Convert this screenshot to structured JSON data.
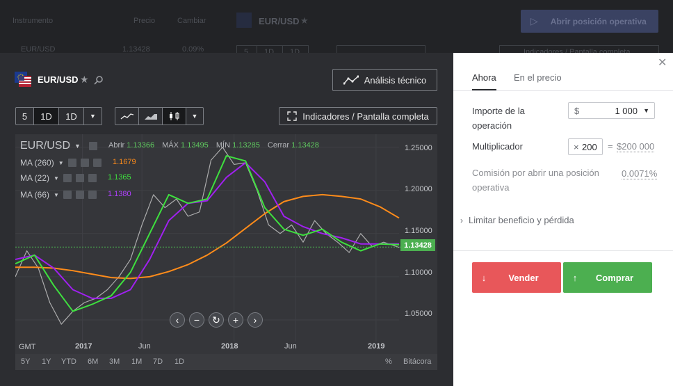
{
  "background": {
    "list_headers": [
      "Instrumento",
      "Precio",
      "Cambiar"
    ],
    "row": {
      "symbol": "EUR/USD",
      "price": "1.13428",
      "change": "0.09%"
    },
    "instrument": "EUR/USD",
    "timeframes": [
      "5",
      "1D",
      "1D"
    ],
    "open_position": "Abrir posición operativa",
    "indicators": "Indicadores / Pantalla completa"
  },
  "chart_header": {
    "instrument": "EUR/USD",
    "analysis_button": "Análisis técnico",
    "timeframes": [
      "5",
      "1D",
      "1D"
    ],
    "indicators_button": "Indicadores / Pantalla completa"
  },
  "chart_data": {
    "type": "line",
    "symbol_label": "EUR/USD",
    "ohlc": [
      {
        "label": "Abrir",
        "value": "1.13366"
      },
      {
        "label": "MÁX",
        "value": "1.13495"
      },
      {
        "label": "MÍN",
        "value": "1.13285"
      },
      {
        "label": "Cerrar",
        "value": "1.13428"
      }
    ],
    "indicators": [
      {
        "name": "MA (260)",
        "value": "1.1679",
        "color": "#ff8c1a"
      },
      {
        "name": "MA (22)",
        "value": "1.1365",
        "color": "#3ee03e"
      },
      {
        "name": "MA (66)",
        "value": "1.1380",
        "color": "#a020f0"
      }
    ],
    "ylim": [
      1.025,
      1.265
    ],
    "y_ticks": [
      "1.25000",
      "1.20000",
      "1.15000",
      "1.10000",
      "1.05000"
    ],
    "x_ticks": [
      "2017",
      "Jun",
      "2018",
      "Jun",
      "2019"
    ],
    "timezone": "GMT",
    "current_price": "1.13428",
    "price_color": "#4caf50",
    "series": [
      {
        "name": "MA (260)",
        "color": "#ff8c1a",
        "x": [
          0,
          5,
          10,
          15,
          20,
          25,
          30,
          35,
          40,
          45,
          50,
          55,
          60,
          65,
          70,
          75,
          80,
          85,
          90,
          95,
          100
        ],
        "values": [
          1.111,
          1.111,
          1.11,
          1.107,
          1.103,
          1.099,
          1.098,
          1.1,
          1.106,
          1.114,
          1.125,
          1.139,
          1.156,
          1.173,
          1.187,
          1.193,
          1.195,
          1.193,
          1.19,
          1.181,
          1.168
        ]
      },
      {
        "name": "MA (22)",
        "color": "#3ee03e",
        "x": [
          0,
          5,
          10,
          15,
          20,
          25,
          30,
          35,
          40,
          45,
          50,
          55,
          60,
          65,
          70,
          75,
          80,
          85,
          90,
          95,
          100
        ],
        "values": [
          1.115,
          1.125,
          1.09,
          1.06,
          1.068,
          1.078,
          1.105,
          1.15,
          1.195,
          1.185,
          1.19,
          1.24,
          1.234,
          1.18,
          1.155,
          1.148,
          1.155,
          1.14,
          1.13,
          1.138,
          1.137
        ]
      },
      {
        "name": "MA (66)",
        "color": "#a020f0",
        "x": [
          0,
          5,
          10,
          15,
          20,
          25,
          30,
          35,
          40,
          45,
          50,
          55,
          60,
          65,
          70,
          75,
          80,
          85,
          90,
          95,
          100
        ],
        "values": [
          1.12,
          1.125,
          1.11,
          1.085,
          1.075,
          1.075,
          1.085,
          1.12,
          1.165,
          1.185,
          1.188,
          1.215,
          1.232,
          1.21,
          1.17,
          1.158,
          1.15,
          1.145,
          1.138,
          1.138,
          1.138
        ]
      },
      {
        "name": "price",
        "color": "#c9c9c9",
        "x": [
          0,
          3,
          6,
          9,
          12,
          15,
          18,
          21,
          24,
          27,
          30,
          33,
          36,
          39,
          42,
          45,
          48,
          51,
          54,
          57,
          60,
          63,
          66,
          69,
          72,
          75,
          78,
          81,
          84,
          87,
          90,
          93,
          96,
          100
        ],
        "values": [
          1.1,
          1.13,
          1.11,
          1.07,
          1.045,
          1.06,
          1.07,
          1.075,
          1.085,
          1.1,
          1.12,
          1.16,
          1.195,
          1.18,
          1.19,
          1.17,
          1.175,
          1.235,
          1.25,
          1.23,
          1.232,
          1.2,
          1.16,
          1.15,
          1.16,
          1.14,
          1.165,
          1.15,
          1.14,
          1.128,
          1.15,
          1.135,
          1.14,
          1.134
        ]
      }
    ]
  },
  "chart_controls": {
    "ranges": [
      "5Y",
      "1Y",
      "YTD",
      "6M",
      "3M",
      "1M",
      "7D",
      "1D"
    ],
    "percent": "%",
    "log": "Bitácora"
  },
  "panel": {
    "tabs": [
      "Ahora",
      "En el precio"
    ],
    "amount_label": "Importe de la operación",
    "amount_currency": "$",
    "amount_value": "1 000",
    "multiplier_label": "Multiplicador",
    "multiplier_prefix": "×",
    "multiplier_value": "200",
    "multiplier_equals": "=",
    "multiplier_result": "$200 000",
    "commission_label": "Comisión por abrir una posición operativa",
    "commission_value": "0.0071%",
    "limit_label": "Limitar beneficio y pérdida",
    "sell_label": "Vender",
    "buy_label": "Comprar",
    "sell_color": "#e8575a",
    "buy_color": "#4caf50"
  }
}
